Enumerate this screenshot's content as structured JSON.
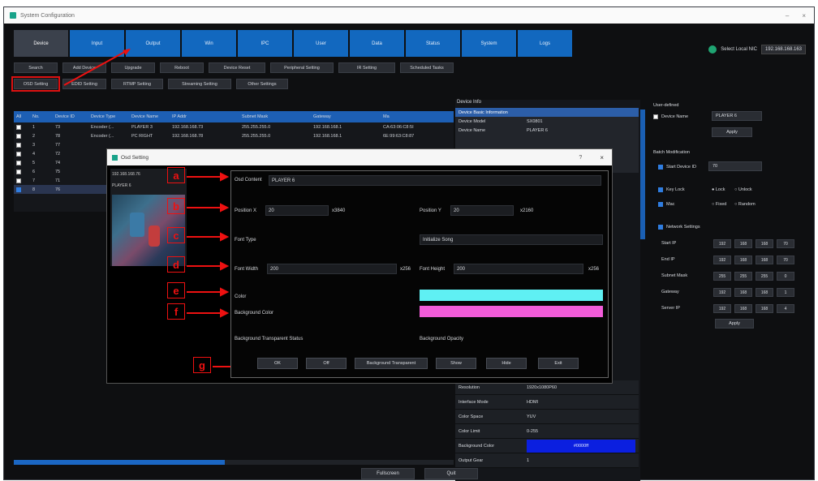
{
  "window": {
    "title": "System Configuration",
    "controls": [
      "–",
      "×"
    ]
  },
  "tabs": [
    "Device",
    "Input",
    "Output",
    "Win",
    "IPC",
    "User",
    "Data",
    "Status",
    "System",
    "Logs"
  ],
  "nic": {
    "label": "Select Local NIC",
    "value": "192.168.168.163"
  },
  "toolbar1": [
    "Search",
    "Add Device",
    "Upgrade",
    "Reboot",
    "Device Reset",
    "Peripheral Setting",
    "IR Setting",
    "Scheduled Tasks"
  ],
  "toolbar2": [
    "OSD Setting",
    "EDID Setting",
    "RTMP Setting",
    "Streaming Setting",
    "Other Settings"
  ],
  "grid": {
    "columns": [
      "All",
      "No.",
      "Device ID",
      "Device Type",
      "Device Name",
      "IP Addr",
      "Subnet Mask",
      "Gateway",
      "Ma"
    ],
    "rows": [
      [
        "",
        "1",
        "73",
        "Encoder (...",
        "PLAYER 3",
        "192.168.168.73",
        "255.255.255.0",
        "192.168.168.1",
        "CA:63:06:C8:5I"
      ],
      [
        "",
        "2",
        "78",
        "Encoder (...",
        "PC RIGHT",
        "192.168.168.78",
        "255.255.255.0",
        "192.168.168.1",
        "6E:99:63:C8:87"
      ],
      [
        "",
        "3",
        "77",
        "",
        "",
        "",
        "",
        "",
        ""
      ],
      [
        "",
        "4",
        "72",
        "",
        "",
        "",
        "",
        "",
        ""
      ],
      [
        "",
        "5",
        "74",
        "",
        "",
        "",
        "",
        "",
        ""
      ],
      [
        "",
        "6",
        "75",
        "",
        "",
        "",
        "",
        "",
        ""
      ],
      [
        "",
        "7",
        "71",
        "",
        "",
        "",
        "",
        "",
        ""
      ],
      [
        "",
        "8",
        "76",
        "",
        "",
        "",
        "",
        "",
        ""
      ]
    ]
  },
  "device_info": {
    "title": "Device Info",
    "header": "Device Basic Information",
    "items": [
      {
        "k": "Device Model",
        "v": "SX0801"
      },
      {
        "k": "Device Name",
        "v": "PLAYER 6"
      }
    ],
    "lower": [
      {
        "k": "Resolution",
        "v": "1920x1080P60"
      },
      {
        "k": "Interface Mode",
        "v": "HDMI"
      },
      {
        "k": "Color Space",
        "v": "YUV"
      },
      {
        "k": "Color Limit",
        "v": "0-255"
      },
      {
        "k": "Background Color",
        "v": "#0000ff"
      },
      {
        "k": "Output Gear",
        "v": "1"
      }
    ]
  },
  "right_panel": {
    "user_defined": "User-defined",
    "device_name_label": "Device Name",
    "device_name_value": "PLAYER 6",
    "apply": "Apply",
    "batch": "Batch Modification",
    "start_device_id": "Start Device ID",
    "start_device_id_value": "70",
    "key_lock": "Key Lock",
    "lock": "Lock",
    "unlock": "Unlock",
    "mac": "Mac",
    "fixed": "Fixed",
    "random": "Random",
    "network_settings": "Network Settings",
    "net_rows": [
      {
        "k": "Start IP",
        "v": [
          "192",
          "168",
          "168",
          "70"
        ]
      },
      {
        "k": "End IP",
        "v": [
          "192",
          "168",
          "168",
          "70"
        ]
      },
      {
        "k": "Subnet Mask",
        "v": [
          "255",
          "255",
          "255",
          "0"
        ]
      },
      {
        "k": "Gateway",
        "v": [
          "192",
          "168",
          "168",
          "1"
        ]
      },
      {
        "k": "Server IP",
        "v": [
          "192",
          "168",
          "168",
          "4"
        ]
      }
    ],
    "apply2": "Apply"
  },
  "bottom": [
    "Fullscreen",
    "Quit"
  ],
  "osd": {
    "title": "Osd Setting",
    "help": "?",
    "close": "×",
    "preview_ip": "192.168.168.76",
    "preview_name": "PLAYER 6",
    "osd_content_label": "Osd Content",
    "osd_content_value": "PLAYER 6",
    "position_x_label": "Position X",
    "position_x_value": "20",
    "position_x_range": "x3840",
    "position_y_label": "Position Y",
    "position_y_value": "20",
    "position_y_range": "x2160",
    "font_type_label": "Font Type",
    "font_type_value": "Initialize Song",
    "font_width_label": "Font Width",
    "font_width_value": "200",
    "font_width_range": "x256",
    "font_height_label": "Font Height",
    "font_height_value": "200",
    "font_height_range": "x256",
    "color_label": "Color",
    "color_value": "#5ff0f3",
    "bg_color_label": "Background Color",
    "bg_color_value": "#f25cd9",
    "bg_transparent_label": "Background Transparent Status",
    "bg_opacity_label": "Background Opacity",
    "buttons": [
      "OK",
      "Off",
      "Background Transparent",
      "Show",
      "Hide",
      "Exit"
    ]
  },
  "annotations": [
    "a",
    "b",
    "c",
    "d",
    "e",
    "f",
    "g"
  ]
}
